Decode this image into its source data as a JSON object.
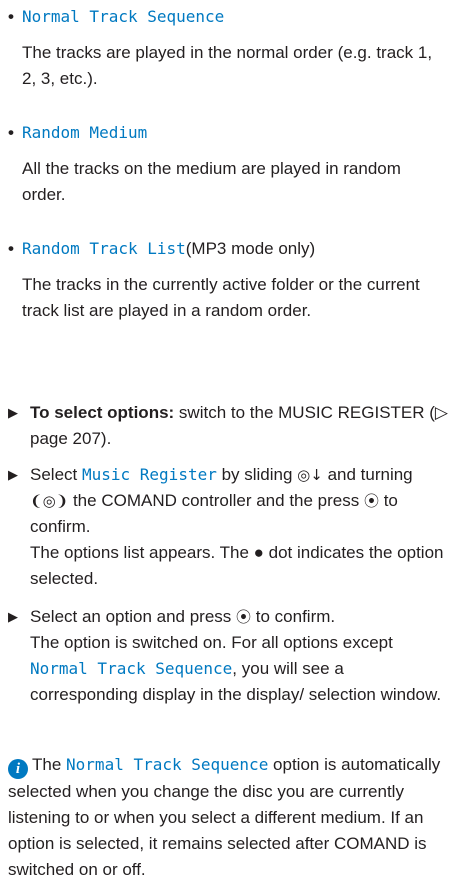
{
  "options": [
    {
      "name": "Normal Track Sequence",
      "suffix": "",
      "description": "The tracks are played in the normal order (e.g. track 1, 2, 3, etc.)."
    },
    {
      "name": "Random Medium",
      "suffix": "",
      "description": "All the tracks on the medium are played in random order."
    },
    {
      "name": "Random Track List",
      "suffix": " (MP3 mode only)",
      "description": "The tracks in the currently active folder or the current track list are played in a random order."
    }
  ],
  "steps": {
    "s1": {
      "bold": "To select options:",
      "text": " switch to the MUSIC REGISTER (▷ page 207)."
    },
    "s2": {
      "pre": "Select ",
      "code": "Music Register",
      "mid1": " by sliding ",
      "mid2": " and turning ",
      "mid3": " the COMAND controller and the press ",
      "end": " to confirm.",
      "result": "The options list appears. The ● dot indicates the option selected."
    },
    "s3": {
      "pre": "Select an option and press ",
      "mid": " to confirm.",
      "result_pre": "The option is switched on. For all options except ",
      "result_code": "Normal Track Sequence",
      "result_post": ", you will see a corresponding display in the display/ selection window."
    }
  },
  "note": {
    "icon": "i",
    "pre": "The ",
    "code": "Normal Track Sequence",
    "post": " option is automatically selected when you change the disc you are currently listening to or when you select a different medium. If an option is selected, it remains selected after COMAND is switched on or off."
  },
  "symbols": {
    "slide_down": "◎↓",
    "turn": "❨◎❩",
    "press": "⦿"
  }
}
